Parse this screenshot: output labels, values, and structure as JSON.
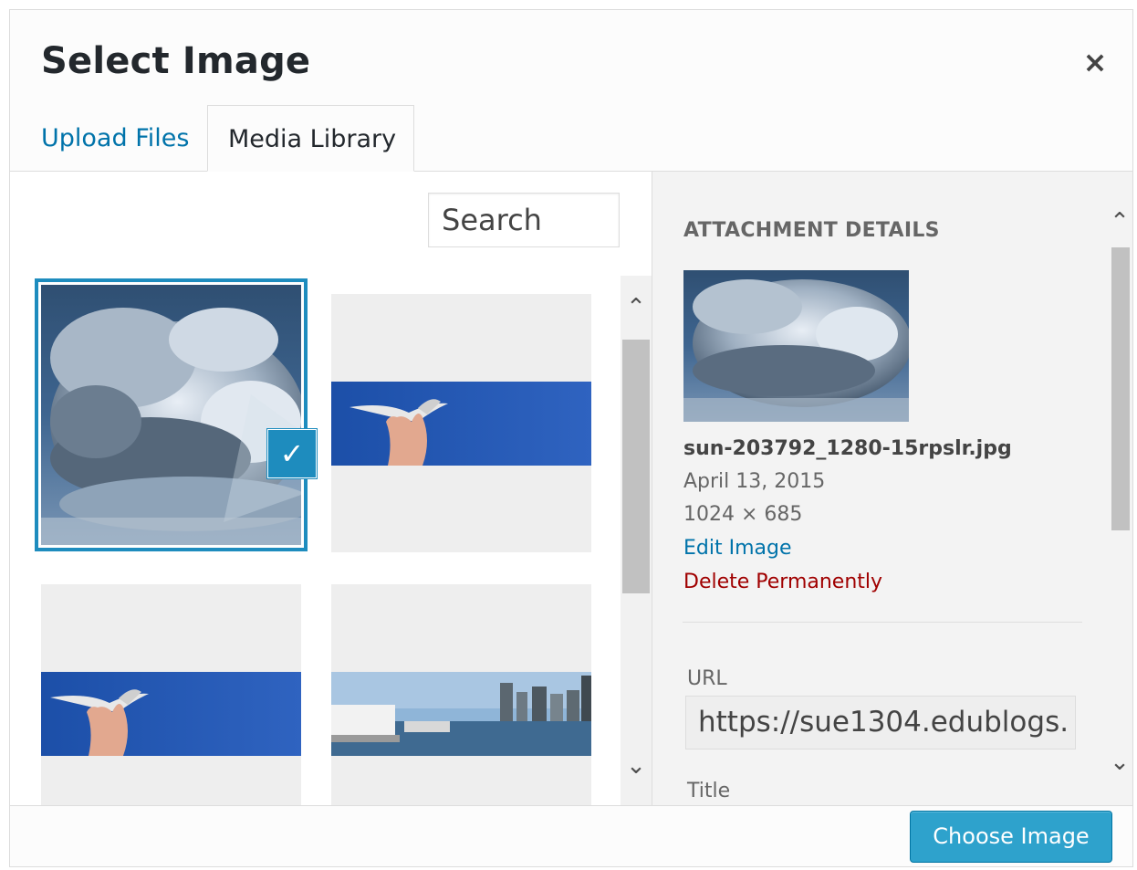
{
  "modal": {
    "title": "Select Image",
    "close_glyph": "×"
  },
  "tabs": [
    {
      "label": "Upload Files",
      "active": false
    },
    {
      "label": "Media Library",
      "active": true
    }
  ],
  "browser": {
    "search_text": "Search",
    "attachments": [
      {
        "image": "clouds-sun-rays-photo",
        "selected": true
      },
      {
        "image": "seagull-in-hand-photo",
        "selected": false
      },
      {
        "image": "seagull-in-hand-photo",
        "selected": false
      },
      {
        "image": "city-harbor-ferry-photo",
        "selected": false
      }
    ],
    "check_glyph": "✓"
  },
  "details": {
    "heading": "ATTACHMENT DETAILS",
    "filename": "sun-203792_1280-15rpslr.jpg",
    "date": "April 13, 2015",
    "dimensions": "1024 × 685",
    "edit_link": "Edit Image",
    "delete_link": "Delete Permanently",
    "url_label": "URL",
    "url_value": "https://sue1304.edublogs.",
    "title_label": "Title"
  },
  "toolbar": {
    "choose_label": "Choose Image"
  },
  "scroll": {
    "up_glyph": "⌃",
    "down_glyph": "⌄"
  },
  "colors": {
    "accent": "#1e8cbe",
    "button": "#2ea2cc",
    "link": "#0073aa",
    "delete": "#a00000"
  }
}
